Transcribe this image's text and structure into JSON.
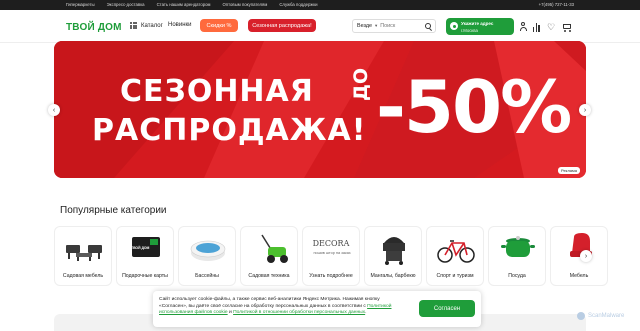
{
  "topbar": {
    "links": [
      "Гипермаркеты",
      "Экспресс-доставка",
      "Стать нашим арендатором",
      "Оптовым покупателям",
      "Служба поддержки"
    ],
    "phone": "+7(495) 727-11-33"
  },
  "header": {
    "logo": "ТВОЙ ДОМ",
    "catalog_label": "Каталог",
    "news_label": "Новинки",
    "discounts_label": "Скидки %",
    "sale_label": "Сезонная распродажа!",
    "search_scope": "Везде",
    "search_placeholder": "Поиск",
    "address_title": "Укажите адрес",
    "address_city": "г.Москва"
  },
  "banner": {
    "line1": "СЕЗОННАЯ",
    "line2": "РАСПРОДАЖА!",
    "prefix": "ДО",
    "discount": "-50%",
    "ad_label": "Реклама"
  },
  "categories": {
    "title": "Популярные категории",
    "items": [
      {
        "label": "Садовая мебель",
        "icon": "garden-furniture-icon"
      },
      {
        "label": "Подарочные карты",
        "icon": "gift-card-icon",
        "card_text": "ТВОЙ ДОМ"
      },
      {
        "label": "Бассейны",
        "icon": "pool-icon"
      },
      {
        "label": "Садовая техника",
        "icon": "lawn-mower-icon"
      },
      {
        "label": "Узнать подробнее",
        "icon": "decora-icon",
        "brand": "DECORA",
        "brand_sub": "пошив штор на заказ"
      },
      {
        "label": "Мангалы, барбекю",
        "icon": "grill-icon"
      },
      {
        "label": "Спорт и туризм",
        "icon": "bicycle-icon"
      },
      {
        "label": "Посуда",
        "icon": "pot-icon"
      },
      {
        "label": "Мебель",
        "icon": "chair-icon"
      }
    ]
  },
  "cookie": {
    "text_part1": "Сайт использует cookie-файлы, а также сервис веб-аналитики Яндекс Метрика. Нажимая кнопку «Согласен», вы даёте своё согласие на обработку персональных данных в соответствии с ",
    "link1": "Политикой использования файлов cookie",
    "text_and": " и ",
    "link2": "Политикой в отношении обработки персональных данных",
    "text_end": ".",
    "accept_label": "Согласен"
  },
  "watermark": "ScanMalware",
  "colors": {
    "brand_green": "#1f9d3a",
    "sale_red": "#d41a1f",
    "discount_orange": "#ff6a3d"
  }
}
